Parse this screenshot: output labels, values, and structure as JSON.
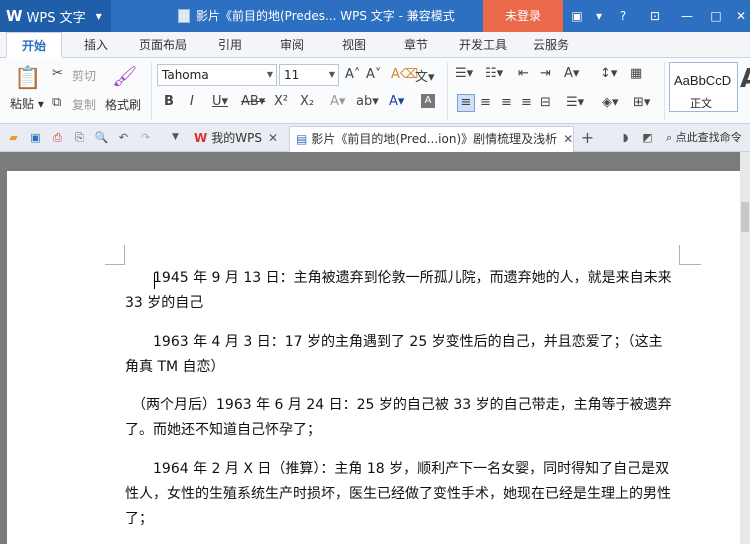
{
  "titlebar": {
    "app_logo": "W",
    "app_name": "WPS 文字",
    "doc_title": "影片《前目的地(Predes... WPS 文字 - 兼容模式",
    "login_label": "未登录",
    "icons": [
      "skin-icon",
      "shirt-icon",
      "help-icon",
      "restore-icon",
      "minimize-icon",
      "maximize-icon",
      "close-icon"
    ]
  },
  "tabs": [
    {
      "label": "开始",
      "active": true
    },
    {
      "label": "插入"
    },
    {
      "label": "页面布局"
    },
    {
      "label": "引用"
    },
    {
      "label": "审阅"
    },
    {
      "label": "视图"
    },
    {
      "label": "章节"
    },
    {
      "label": "开发工具"
    },
    {
      "label": "云服务"
    }
  ],
  "ribbon": {
    "paste_label": "粘贴",
    "cut_label": "剪切",
    "copy_label": "复制",
    "format_painter_label": "格式刷",
    "font_name": "Tahoma",
    "font_size": "11",
    "style_sample": "AaBbCcD",
    "style_name": "正文"
  },
  "quickbar": {
    "doctabs": [
      {
        "label": "我的WPS",
        "logo": "W"
      },
      {
        "label": "影片《前目的地(Pred...ion)》剧情梳理及浅析",
        "active": true
      }
    ],
    "add_tab": "+",
    "search_label": "点此查找命令"
  },
  "document": {
    "paragraphs": [
      "　　1945 年 9 月 13 日：主角被遗弃到伦敦一所孤儿院，而遗弃她的人，就是来自未来 33 岁的自己",
      "　　1963 年 4 月 3 日：17 岁的主角遇到了 25 岁变性后的自己，并且恋爱了；（这主角真 TM 自恋）",
      "　（两个月后）1963 年 6 月 24 日：25 岁的自己被 33 岁的自己带走，主角等于被遗弃了。而她还不知道自己怀孕了；",
      "　　1964 年 2 月 X 日（推算）：主角 18 岁，顺利产下一名女婴，同时得知了自己是双性人，女性的生殖系统生产时损坏，医生已经做了变性手术，她现在已经是生理上的男性了；"
    ]
  },
  "colors": {
    "title_blue": "#2d6fc1",
    "login_orange": "#e9694a"
  }
}
